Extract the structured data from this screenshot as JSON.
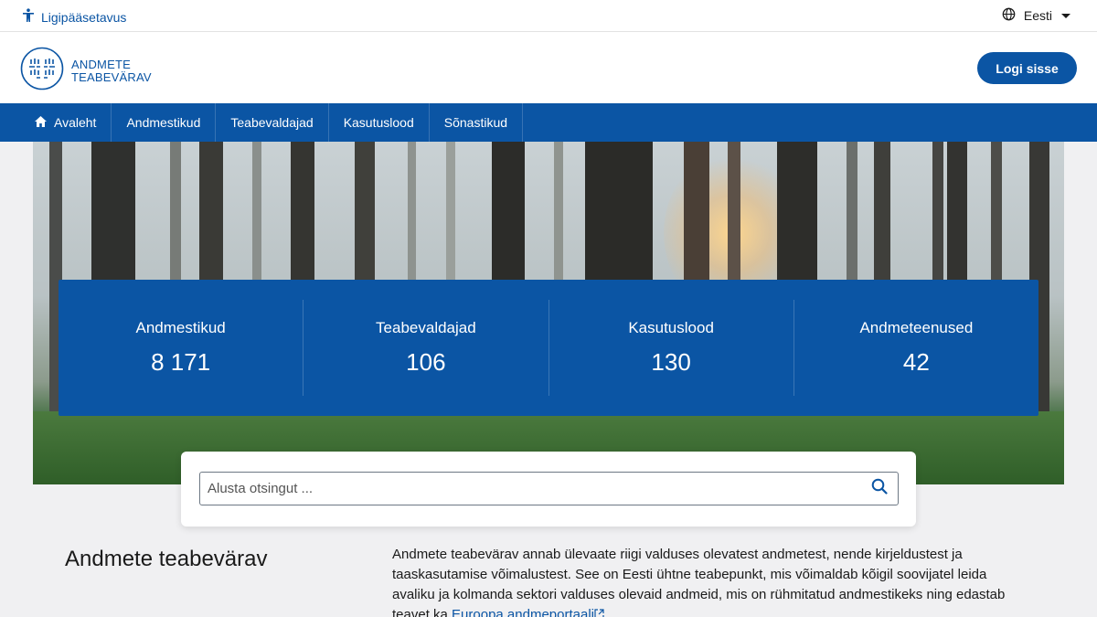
{
  "topbar": {
    "accessibility_label": "Ligipääsetavus",
    "language": "Eesti"
  },
  "header": {
    "logo_line1": "ANDMETE",
    "logo_line2": "TEABEVÄRAV",
    "login_label": "Logi sisse"
  },
  "nav": {
    "items": [
      {
        "label": "Avaleht",
        "icon": "home-icon"
      },
      {
        "label": "Andmestikud"
      },
      {
        "label": "Teabevaldajad"
      },
      {
        "label": "Kasutuslood"
      },
      {
        "label": "Sõnastikud"
      }
    ]
  },
  "stats": [
    {
      "label": "Andmestikud",
      "value": "8 171"
    },
    {
      "label": "Teabevaldajad",
      "value": "106"
    },
    {
      "label": "Kasutuslood",
      "value": "130"
    },
    {
      "label": "Andmeteenused",
      "value": "42"
    }
  ],
  "search": {
    "placeholder": "Alusta otsingut ..."
  },
  "intro": {
    "title": "Andmete teabevärav",
    "text": "Andmete teabevärav annab ülevaate riigi valduses olevatest andmetest, nende kirjeldustest ja taaskasutamise võimalustest. See on Eesti ühtne teabepunkt, mis võimaldab kõigil soovijatel leida avaliku ja kolmanda sektori valduses olevaid andmeid, mis on rühmitatud andmestikeks ning edastab teavet ka",
    "link_label": "Euroopa andmeportaali"
  },
  "colors": {
    "brand": "#0b55a4",
    "background": "#f0f0f2"
  }
}
